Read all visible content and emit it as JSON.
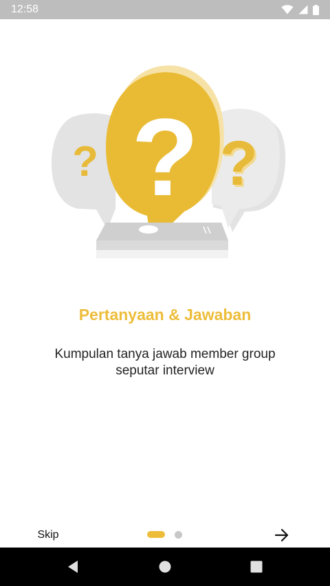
{
  "status_bar": {
    "time": "12:58",
    "icons": [
      "wifi-icon",
      "cellular-signal-icon",
      "battery-icon"
    ]
  },
  "onboarding": {
    "illustration": "question-bubbles-illustration",
    "title": "Pertanyaan & Jawaban",
    "description": "Kumpulan tanya jawab member group seputar interview",
    "page_count": 2,
    "current_page": 1
  },
  "footer": {
    "skip_label": "Skip",
    "next_icon": "arrow-right-icon"
  },
  "nav_bar": {
    "icons": [
      "back-icon",
      "home-icon",
      "recents-icon"
    ]
  },
  "colors": {
    "accent": "#edbd3a",
    "status_bar": "#bdbdbd",
    "nav_bar": "#000000",
    "inactive_dot": "#c7c7c7"
  }
}
